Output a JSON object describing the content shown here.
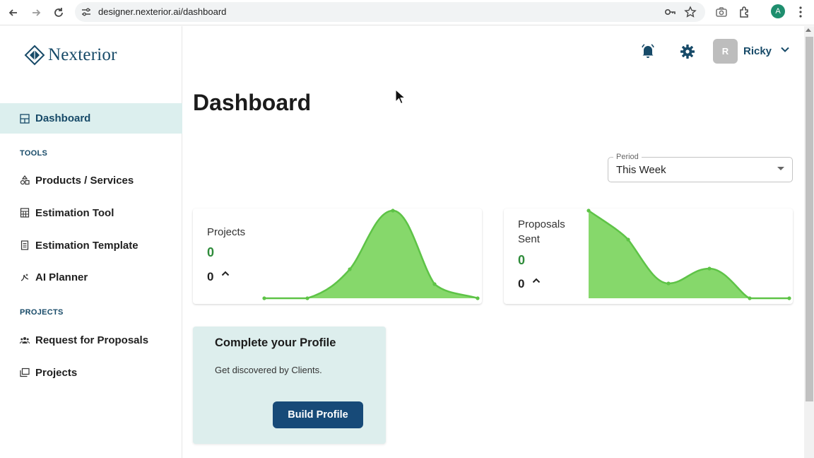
{
  "browser": {
    "url": "designer.nexterior.ai/dashboard",
    "profile_initial": "A",
    "icons": [
      "back-arrow-icon",
      "forward-arrow-icon",
      "reload-icon",
      "site-settings-icon",
      "password-key-icon",
      "bookmark-star-icon",
      "camera-icon",
      "extensions-icon",
      "menu-dots-icon"
    ]
  },
  "sidebar": {
    "logo_text": "Nexterior",
    "active_item": {
      "label": "Dashboard",
      "icon": "dashboard-icon"
    },
    "sections": [
      {
        "title": "TOOLS",
        "items": [
          {
            "label": "Products / Services",
            "icon": "shapes-icon"
          },
          {
            "label": "Estimation Tool",
            "icon": "calculator-icon"
          },
          {
            "label": "Estimation Template",
            "icon": "document-icon"
          },
          {
            "label": "AI Planner",
            "icon": "sparkle-icon"
          }
        ]
      },
      {
        "title": "PROJECTS",
        "items": [
          {
            "label": "Request for Proposals",
            "icon": "people-icon"
          },
          {
            "label": "Projects",
            "icon": "folders-icon"
          }
        ]
      }
    ]
  },
  "header": {
    "user_name": "Ricky",
    "avatar_initial": "R"
  },
  "main": {
    "title": "Dashboard",
    "period": {
      "label": "Period",
      "value": "This Week"
    },
    "cards": [
      {
        "title": "Projects",
        "value": "0",
        "change": "0"
      },
      {
        "title": "Proposals Sent",
        "value": "0",
        "change": "0"
      }
    ],
    "profile_card": {
      "title": "Complete your Profile",
      "text": "Get discovered by Clients.",
      "button": "Build Profile"
    }
  },
  "colors": {
    "brand": "#174a68",
    "active_bg": "#dcefee",
    "chart_fill": "#86d86b",
    "chart_line": "#5ec347",
    "value_green": "#2e8b3a",
    "button": "#174a78"
  }
}
